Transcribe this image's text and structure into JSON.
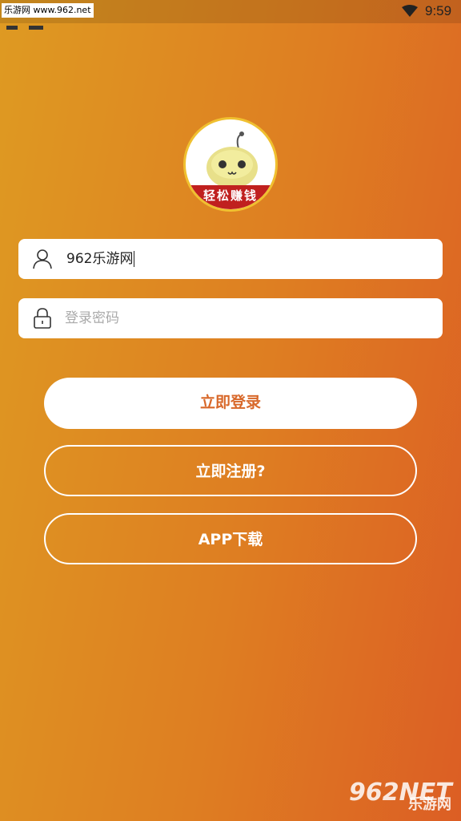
{
  "status_bar": {
    "watermark": "乐游网 www.962.net",
    "time": "9:59"
  },
  "logo": {
    "banner_text": "轻松赚钱"
  },
  "form": {
    "username_value": "962乐游网",
    "password_placeholder": "登录密码"
  },
  "buttons": {
    "login": "立即登录",
    "register": "立即注册?",
    "download": "APP下载"
  },
  "footer_watermark": {
    "number": "962NET",
    "site": "乐游网"
  },
  "colors": {
    "gradient_start": "#de9a22",
    "gradient_end": "#dc5e24",
    "login_text": "#d8682a"
  }
}
